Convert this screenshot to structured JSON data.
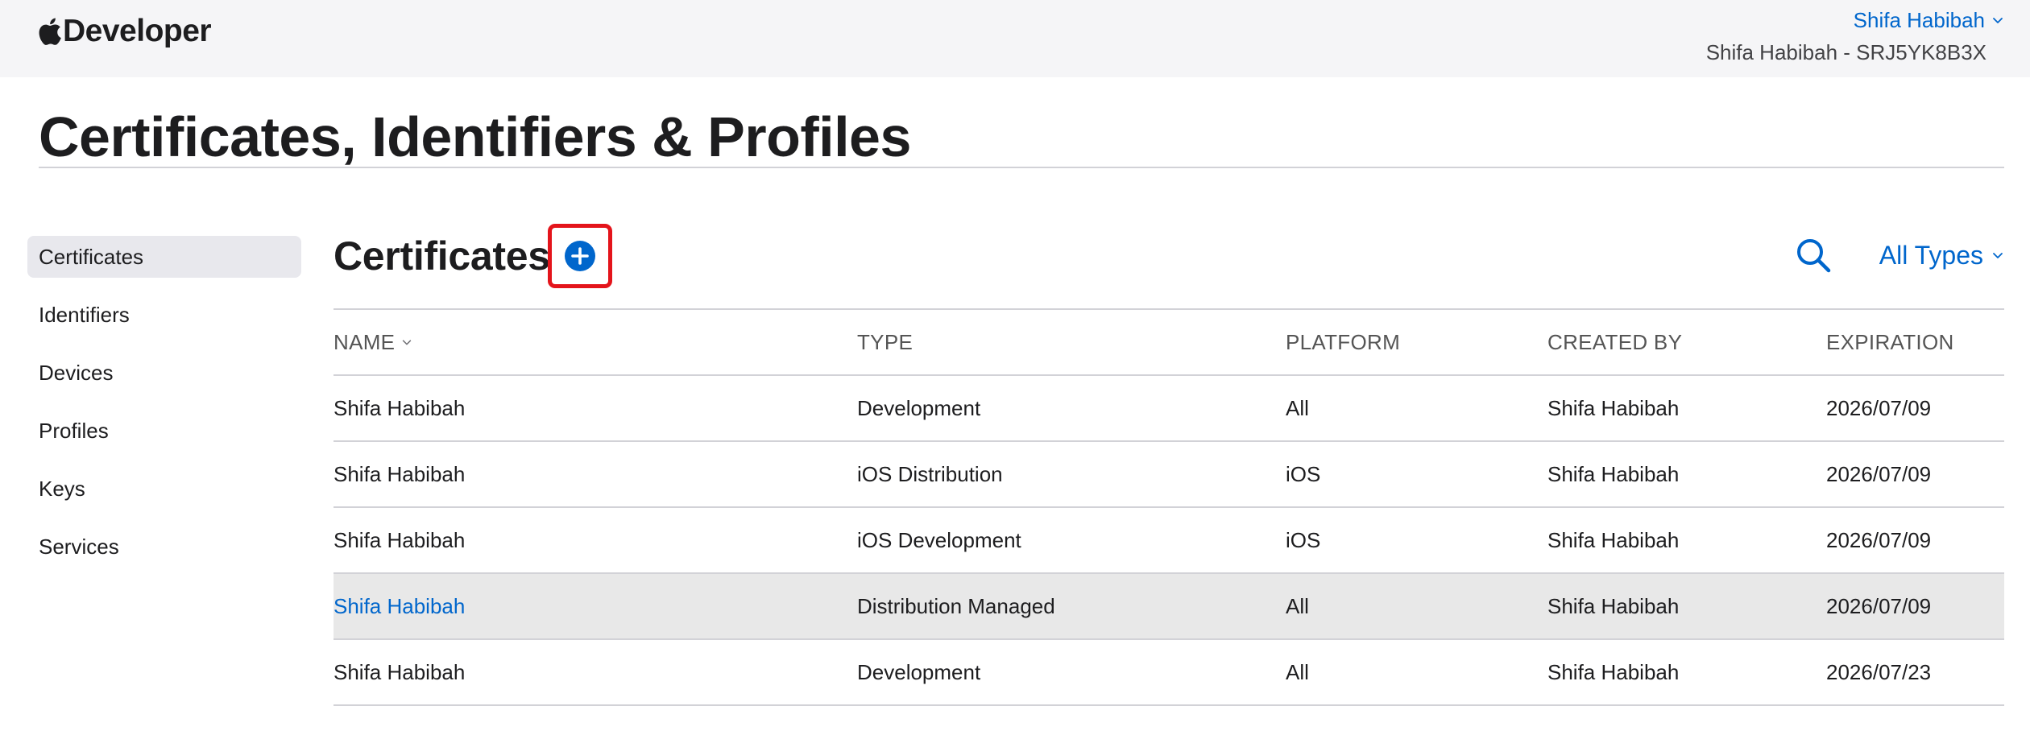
{
  "header": {
    "brand_label": "Developer",
    "account_name": "Shifa Habibah",
    "team_label": "Shifa Habibah - SRJ5YK8B3X"
  },
  "page": {
    "title": "Certificates, Identifiers & Profiles"
  },
  "sidebar": {
    "items": [
      {
        "label": "Certificates",
        "active": true
      },
      {
        "label": "Identifiers"
      },
      {
        "label": "Devices"
      },
      {
        "label": "Profiles"
      },
      {
        "label": "Keys"
      },
      {
        "label": "Services"
      }
    ]
  },
  "section": {
    "title": "Certificates",
    "filter_label": "All Types"
  },
  "table": {
    "columns": [
      "NAME",
      "TYPE",
      "PLATFORM",
      "CREATED BY",
      "EXPIRATION"
    ],
    "rows": [
      {
        "name": "Shifa Habibah",
        "type": "Development",
        "platform": "All",
        "created_by": "Shifa Habibah",
        "expiration": "2026/07/09"
      },
      {
        "name": "Shifa Habibah",
        "type": "iOS Distribution",
        "platform": "iOS",
        "created_by": "Shifa Habibah",
        "expiration": "2026/07/09"
      },
      {
        "name": "Shifa Habibah",
        "type": "iOS Development",
        "platform": "iOS",
        "created_by": "Shifa Habibah",
        "expiration": "2026/07/09"
      },
      {
        "name": "Shifa Habibah",
        "type": "Distribution Managed",
        "platform": "All",
        "created_by": "Shifa Habibah",
        "expiration": "2026/07/09"
      },
      {
        "name": "Shifa Habibah",
        "type": "Development",
        "platform": "All",
        "created_by": "Shifa Habibah",
        "expiration": "2026/07/23"
      }
    ]
  },
  "icons": {
    "brand": "apple-logo-icon",
    "add": "plus-circle-icon",
    "search": "search-icon",
    "chevron": "chevron-down-icon"
  },
  "colors": {
    "accent": "#0066cc",
    "highlight_box": "#e4141b",
    "header_bg": "#f5f5f7",
    "selected_row": "#e8e8e8"
  }
}
